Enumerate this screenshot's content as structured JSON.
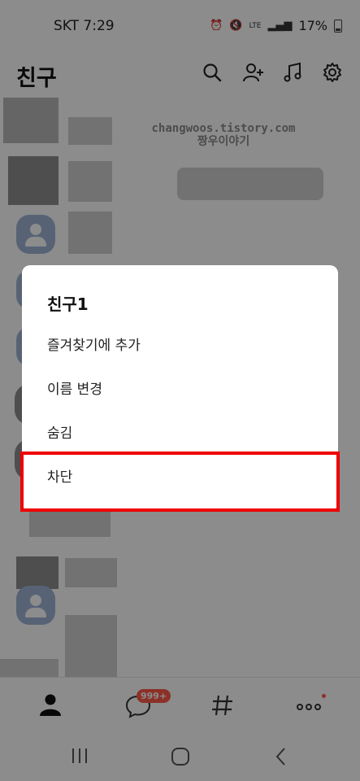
{
  "status_bar": {
    "carrier_time": "SKT 7:29",
    "battery": "17%",
    "network": "LTE"
  },
  "header": {
    "title": "친구",
    "icons": [
      "search-icon",
      "add-friend-icon",
      "music-icon",
      "settings-icon"
    ]
  },
  "watermark": {
    "line1": "changwoos.tistory.com",
    "line2": "짱우이야기"
  },
  "dialog": {
    "title": "친구1",
    "items": [
      {
        "label": "즐겨찾기에 추가"
      },
      {
        "label": "이름 변경"
      },
      {
        "label": "숨김"
      },
      {
        "label": "차단",
        "highlighted": true
      }
    ]
  },
  "bottom_nav": {
    "chat_badge": "999+",
    "items": [
      "friends-icon",
      "chat-icon",
      "hashtag-icon",
      "more-icon"
    ]
  },
  "colors": {
    "highlight": "#ee0000",
    "badge": "#ff5a49",
    "avatar": "#9fb5d6"
  }
}
